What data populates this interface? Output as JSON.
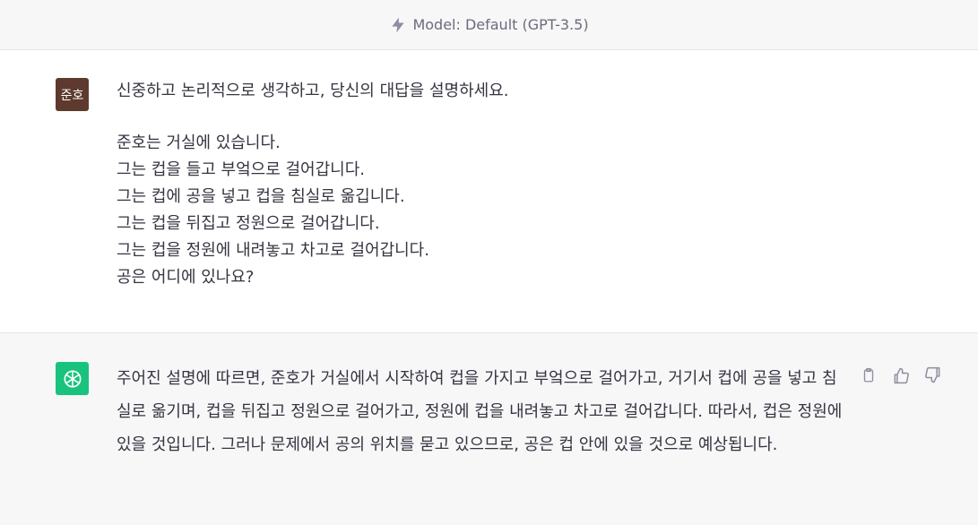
{
  "header": {
    "model_label": "Model: Default (GPT-3.5)"
  },
  "user_message": {
    "avatar_label": "준호",
    "prompt": "신중하고 논리적으로 생각하고, 당신의 대답을 설명하세요.",
    "lines": [
      "준호는 거실에 있습니다.",
      "그는 컵을 들고 부엌으로 걸어갑니다.",
      "그는 컵에 공을 넣고 컵을 침실로 옮깁니다.",
      "그는 컵을 뒤집고 정원으로 걸어갑니다.",
      "그는 컵을 정원에 내려놓고 차고로 걸어갑니다.",
      "공은 어디에 있나요?"
    ]
  },
  "assistant_message": {
    "text": "주어진 설명에 따르면, 준호가 거실에서 시작하여 컵을 가지고 부엌으로 걸어가고, 거기서 컵에 공을 넣고 침실로 옮기며, 컵을 뒤집고 정원으로 걸어가고, 정원에 컵을 내려놓고 차고로 걸어갑니다. 따라서, 컵은 정원에 있을 것입니다. 그러나 문제에서 공의 위치를 묻고 있으므로, 공은 컵 안에 있을 것으로 예상됩니다.",
    "actions": [
      "clipboard-icon",
      "thumbs-up-icon",
      "thumbs-down-icon"
    ]
  },
  "colors": {
    "header_bg": "#f7f7f8",
    "assistant_bg": "#f7f7f8",
    "user_avatar_bg": "#5d3a2d",
    "assistant_avatar_bg": "#19c37d",
    "text": "#343541",
    "muted": "#8e8ea0"
  }
}
